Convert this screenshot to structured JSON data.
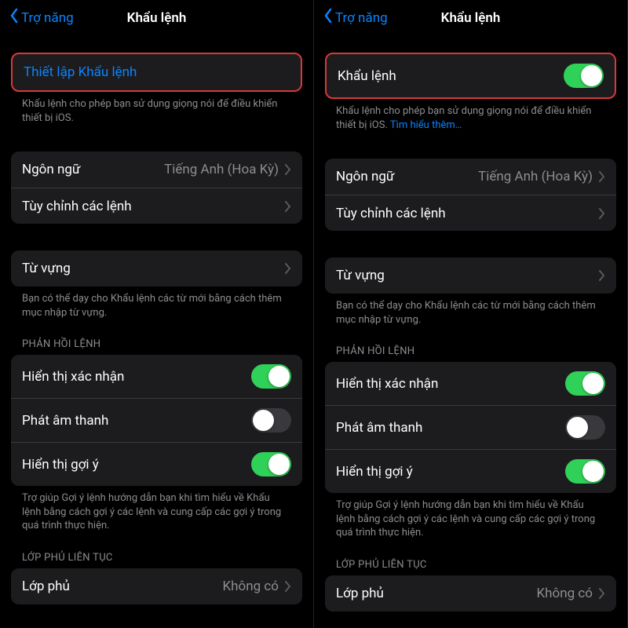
{
  "nav": {
    "back": "Trợ năng",
    "title": "Khẩu lệnh"
  },
  "left": {
    "setup_label": "Thiết lập Khẩu lệnh",
    "desc": "Khẩu lệnh cho phép bạn sử dụng giọng nói để điều khiển thiết bị iOS."
  },
  "right": {
    "toggle_label": "Khẩu lệnh",
    "desc": "Khẩu lệnh cho phép bạn sử dụng giọng nói để điều khiển thiết bị iOS. ",
    "learn_more": "Tìm hiểu thêm…"
  },
  "language": {
    "label": "Ngôn ngữ",
    "value": "Tiếng Anh (Hoa Kỳ)"
  },
  "customize": {
    "label": "Tùy chỉnh các lệnh"
  },
  "vocab": {
    "label": "Từ vựng",
    "footer": "Bạn có thể dạy cho Khẩu lệnh các từ mới bằng cách thêm mục nhập từ vựng."
  },
  "feedback": {
    "header": "PHẢN HỒI LỆNH",
    "confirm": "Hiển thị xác nhận",
    "sound": "Phát âm thanh",
    "hints": "Hiển thị gợi ý",
    "footer": "Trợ giúp Gợi ý lệnh hướng dẫn bạn khi tìm hiểu về Khẩu lệnh bằng cách gợi ý các lệnh và cung cấp các gợi ý trong quá trình thực hiện."
  },
  "overlay": {
    "header": "LỚP PHỦ LIÊN TỤC",
    "label": "Lớp phủ",
    "value": "Không có"
  }
}
